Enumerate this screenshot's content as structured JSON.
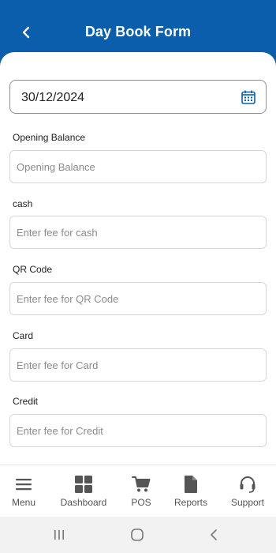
{
  "header": {
    "title": "Day Book Form"
  },
  "form": {
    "date_value": "30/12/2024",
    "opening_balance": {
      "label": "Opening Balance",
      "placeholder": "Opening Balance",
      "value": ""
    },
    "cash": {
      "label": "cash",
      "placeholder": "Enter fee for cash",
      "value": ""
    },
    "qr_code": {
      "label": "QR Code",
      "placeholder": "Enter fee for QR Code",
      "value": ""
    },
    "card": {
      "label": "Card",
      "placeholder": "Enter fee for Card",
      "value": ""
    },
    "credit": {
      "label": "Credit",
      "placeholder": "Enter fee for Credit",
      "value": ""
    }
  },
  "bottom_nav": {
    "items": [
      {
        "label": "Menu",
        "icon": "menu-icon"
      },
      {
        "label": "Dashboard",
        "icon": "dashboard-icon"
      },
      {
        "label": "POS",
        "icon": "cart-icon"
      },
      {
        "label": "Reports",
        "icon": "document-icon"
      },
      {
        "label": "Support",
        "icon": "headset-icon"
      }
    ]
  },
  "colors": {
    "header_bg": "#0b5eab",
    "nav_icon": "#555555",
    "calendar_icon": "#0b5eab"
  }
}
